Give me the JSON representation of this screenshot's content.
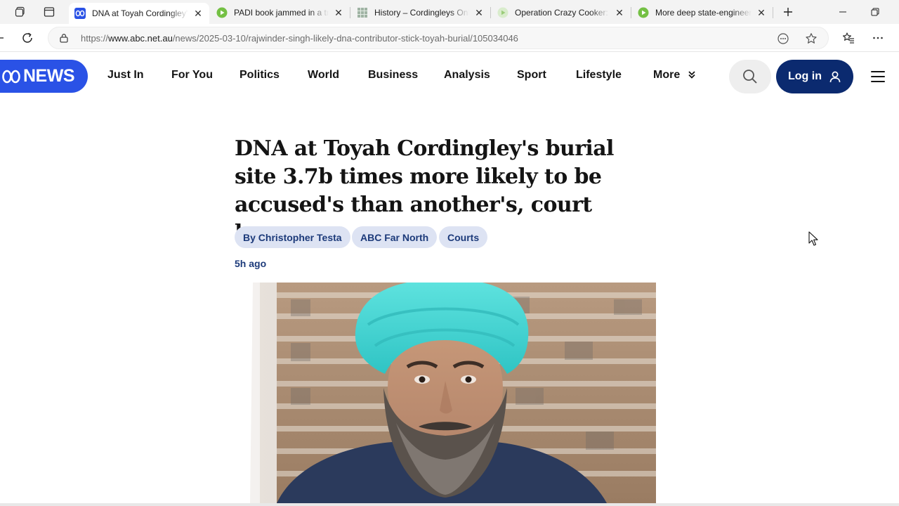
{
  "browser": {
    "tabs": [
      {
        "title": "DNA at Toyah Cordingley's",
        "favicon": "abc-news-icon",
        "active": true
      },
      {
        "title": "PADI book jammed in a tre",
        "favicon": "rumble-play-icon",
        "active": false
      },
      {
        "title": "History – Cordingleys Onli",
        "favicon": "grid-site-icon",
        "active": false
      },
      {
        "title": "Operation Crazy Cooker: M",
        "favicon": "rumble-play-icon",
        "active": false
      },
      {
        "title": "More deep state-engineere",
        "favicon": "rumble-play-icon",
        "active": false
      }
    ],
    "address": {
      "url_prefix": "https://",
      "url_host": "www.abc.net.au",
      "url_path": "/news/2025-03-10/rajwinder-singh-likely-dna-contributor-stick-toyah-burial/105034046"
    }
  },
  "site": {
    "logo_text": "NEWS",
    "nav": [
      "Just In",
      "For You",
      "Politics",
      "World",
      "Business",
      "Analysis",
      "Sport",
      "Lifestyle",
      "More"
    ],
    "login_label": "Log in",
    "brand_color": "#2a52e6",
    "login_color": "#0b2a6f"
  },
  "article": {
    "headline": "DNA at Toyah Cordingley's burial site 3.7b times more likely to be accused's than another's, court hears",
    "tags": [
      "By Christopher Testa",
      "ABC Far North",
      "Courts"
    ],
    "timestamp": "5h ago",
    "pill_color": "#dde3f3"
  }
}
